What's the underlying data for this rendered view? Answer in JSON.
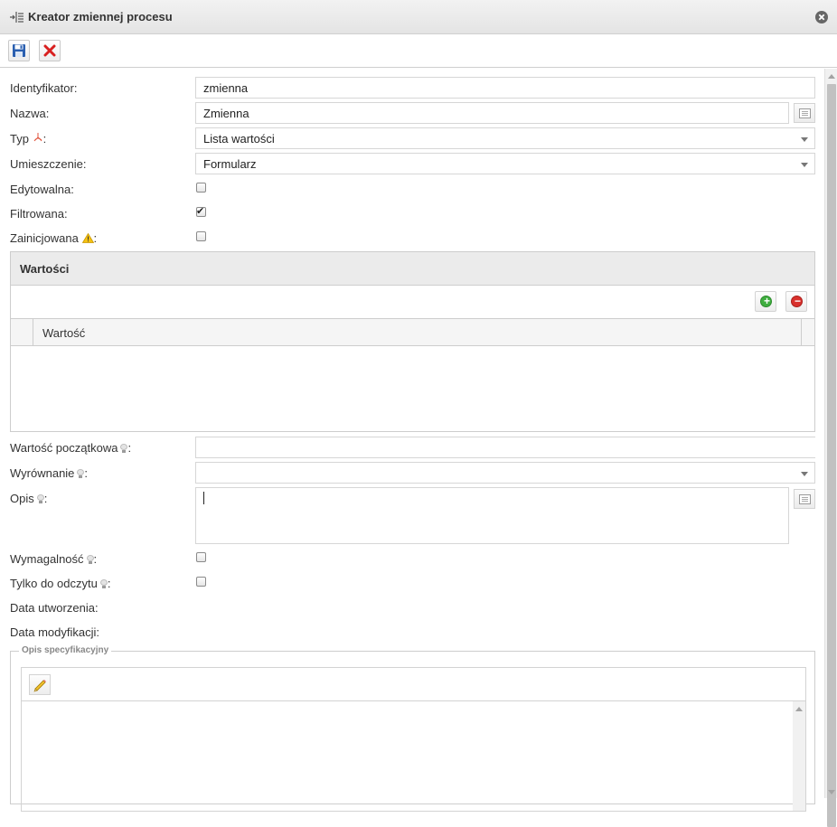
{
  "window": {
    "title": "Kreator zmiennej procesu",
    "close_icon": "close-circle-icon"
  },
  "toolbar": {
    "save_icon": "save-icon",
    "cancel_icon": "delete-x-icon"
  },
  "form": {
    "identifier_label": "Identyfikator:",
    "identifier_value": "zmienna",
    "name_label": "Nazwa:",
    "name_value": "Zmienna",
    "type_label_prefix": "Typ",
    "type_label_suffix": ":",
    "type_value": "Lista wartości",
    "placement_label": "Umieszczenie:",
    "placement_value": "Formularz",
    "editable_label": "Edytowalna:",
    "editable_checked": false,
    "filtered_label": "Filtrowana:",
    "filtered_checked": true,
    "initiated_label_prefix": "Zainicjowana",
    "initiated_label_suffix": ":",
    "initiated_checked": false,
    "initial_value_label_prefix": "Wartość początkowa",
    "initial_value_label_suffix": ":",
    "initial_value": "",
    "alignment_label_prefix": "Wyrównanie",
    "alignment_label_suffix": ":",
    "alignment_value": "",
    "description_label_prefix": "Opis",
    "description_label_suffix": ":",
    "description_value": "",
    "required_label_prefix": "Wymagalność",
    "required_label_suffix": ":",
    "required_checked": false,
    "readonly_label_prefix": "Tylko do odczytu",
    "readonly_label_suffix": ":",
    "readonly_checked": false,
    "created_label": "Data utworzenia:",
    "modified_label": "Data modyfikacji:"
  },
  "values_panel": {
    "title": "Wartości",
    "column_header": "Wartość",
    "add_label": "+",
    "remove_label": "−",
    "rows": []
  },
  "spec": {
    "legend": "Opis specyfikacyjny",
    "edit_icon": "pencil-icon"
  },
  "colors": {
    "add": "#3fae3f",
    "remove": "#d9302c",
    "save": "#2a5fb0",
    "cancel": "#d81f1f"
  }
}
